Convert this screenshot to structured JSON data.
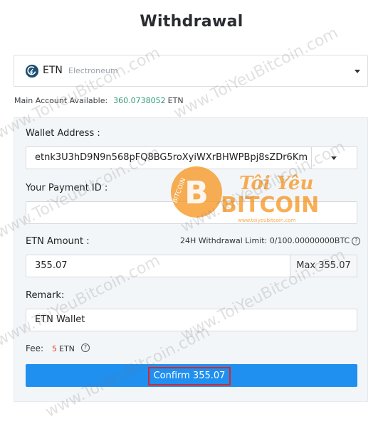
{
  "page": {
    "title": "Withdrawal"
  },
  "coin": {
    "code": "ETN",
    "name": "Electroneum"
  },
  "account": {
    "label": "Main Account Available:",
    "amount": "360.0738052",
    "unit": "ETN"
  },
  "form": {
    "wallet_label": "Wallet Address :",
    "wallet_value": "etnk3U3hD9N9n568pFQ8BG5roXyiWXrBHWPBpj8sZDr6Km",
    "payment_id_label": "Your Payment ID :",
    "payment_id_value": "",
    "amount_label": "ETN Amount :",
    "limit_text": "24H Withdrawal Limit: 0/100.00000000BTC",
    "amount_value": "355.07",
    "max_label": "Max 355.07",
    "remark_label": "Remark:",
    "remark_value": "ETN Wallet",
    "fee_label": "Fee:",
    "fee_value": "5",
    "fee_unit": "ETN",
    "confirm_label": "Confirm 355.07"
  },
  "watermark": {
    "site_text": "www.ToiYeuBitcoin.com",
    "logo_line1": "Tôi Yêu",
    "logo_line2": "BITCOIN",
    "logo_url": "www.toiyeubitcoin.com",
    "logo_badge": "BITCOIN"
  },
  "colors": {
    "primary_button": "#1f8ff0",
    "highlight_border": "#e02424",
    "available_amount": "#2f9a7a",
    "fee_amount": "#e0362d",
    "panel_bg": "#f3f6f9",
    "watermark_orange": "#f7931a"
  }
}
